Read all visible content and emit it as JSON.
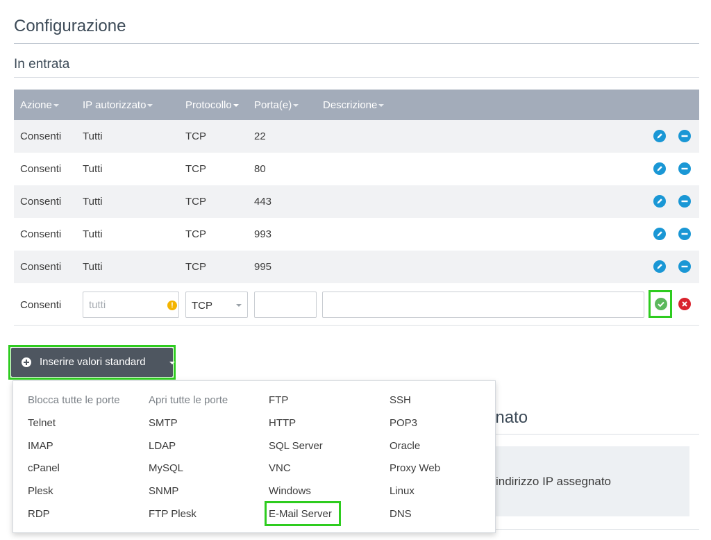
{
  "title": "Configurazione",
  "section_title": "In entrata",
  "table": {
    "headers": [
      "Azione",
      "IP autorizzato",
      "Protocollo",
      "Porta(e)",
      "Descrizione"
    ],
    "rows": [
      {
        "action": "Consenti",
        "ip": "Tutti",
        "protocol": "TCP",
        "port": "22"
      },
      {
        "action": "Consenti",
        "ip": "Tutti",
        "protocol": "TCP",
        "port": "80"
      },
      {
        "action": "Consenti",
        "ip": "Tutti",
        "protocol": "TCP",
        "port": "443"
      },
      {
        "action": "Consenti",
        "ip": "Tutti",
        "protocol": "TCP",
        "port": "993"
      },
      {
        "action": "Consenti",
        "ip": "Tutti",
        "protocol": "TCP",
        "port": "995"
      }
    ]
  },
  "new_rule": {
    "action": "Consenti",
    "ip_placeholder": "tutti",
    "warning_glyph": "!",
    "protocol": "TCP",
    "port_value": "",
    "description_value": ""
  },
  "standard_button": {
    "label": "Inserire valori standard"
  },
  "background_section": {
    "title_fragment": "gnato",
    "text_fragment": "indirizzo IP assegnato"
  },
  "dropdown": {
    "col1": [
      "Blocca tutte le porte",
      "Telnet",
      "IMAP",
      "cPanel",
      "Plesk",
      "RDP"
    ],
    "col2": [
      "Apri tutte le porte",
      "SMTP",
      "LDAP",
      "MySQL",
      "SNMP",
      "FTP Plesk"
    ],
    "col3": [
      "FTP",
      "HTTP",
      "SQL Server",
      "VNC",
      "Windows",
      "E-Mail Server"
    ],
    "col4": [
      "SSH",
      "POP3",
      "Oracle",
      "Proxy Web",
      "Linux",
      "DNS"
    ]
  },
  "colors": {
    "header_bg": "#a3acba",
    "action_icon": "#1a97d5",
    "highlight": "#2ecc1f",
    "confirm": "#5cb85c",
    "cancel": "#d9232d",
    "button_bg": "#4e5660"
  }
}
